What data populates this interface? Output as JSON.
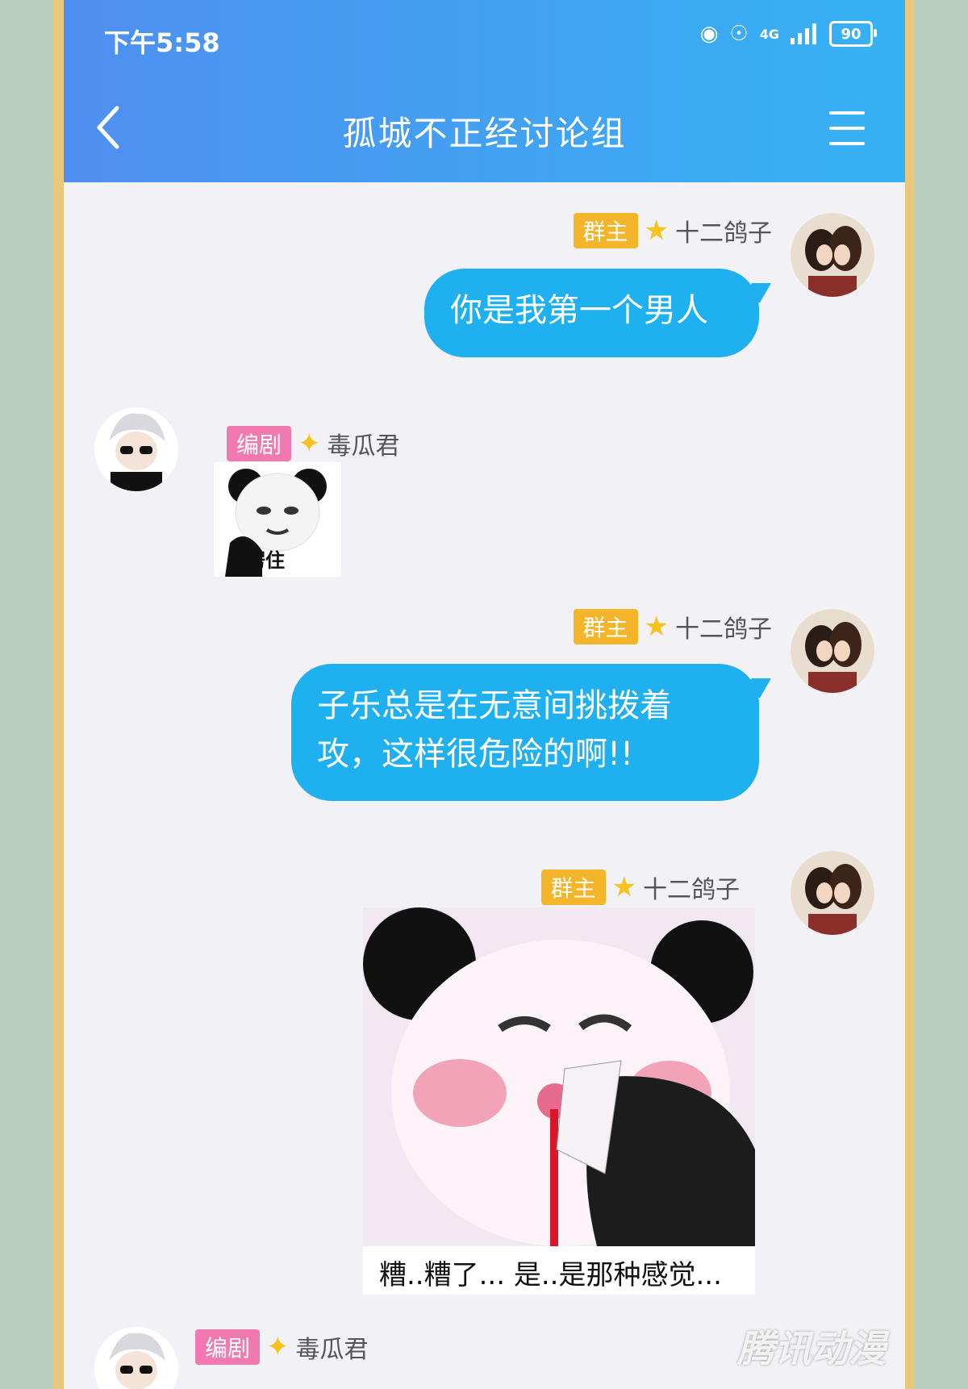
{
  "status_bar": {
    "time": "下午5:58",
    "network": "4G",
    "battery": "90"
  },
  "header": {
    "title": "孤城不正经讨论组"
  },
  "messages": [
    {
      "role": "群主",
      "sender": "十二鸽子",
      "text": "你是我第一个男人"
    },
    {
      "role": "编剧",
      "sender": "毒瓜君",
      "sticker_caption": "愣住"
    },
    {
      "role": "群主",
      "sender": "十二鸽子",
      "text_line1": "子乐总是在无意间挑拨着",
      "text_line2": "攻，这样很危险的啊!!"
    },
    {
      "role": "群主",
      "sender": "十二鸽子",
      "sticker_caption": "糟..糟了...  是..是那种感觉..."
    },
    {
      "role": "编剧",
      "sender": "毒瓜君"
    }
  ],
  "watermark": "腾讯动漫",
  "colors": {
    "header_start": "#4f8ff0",
    "header_end": "#36b2f4",
    "bubble": "#1fb0f0",
    "owner_badge": "#f5b52a",
    "editor_badge": "#f07ab0"
  }
}
